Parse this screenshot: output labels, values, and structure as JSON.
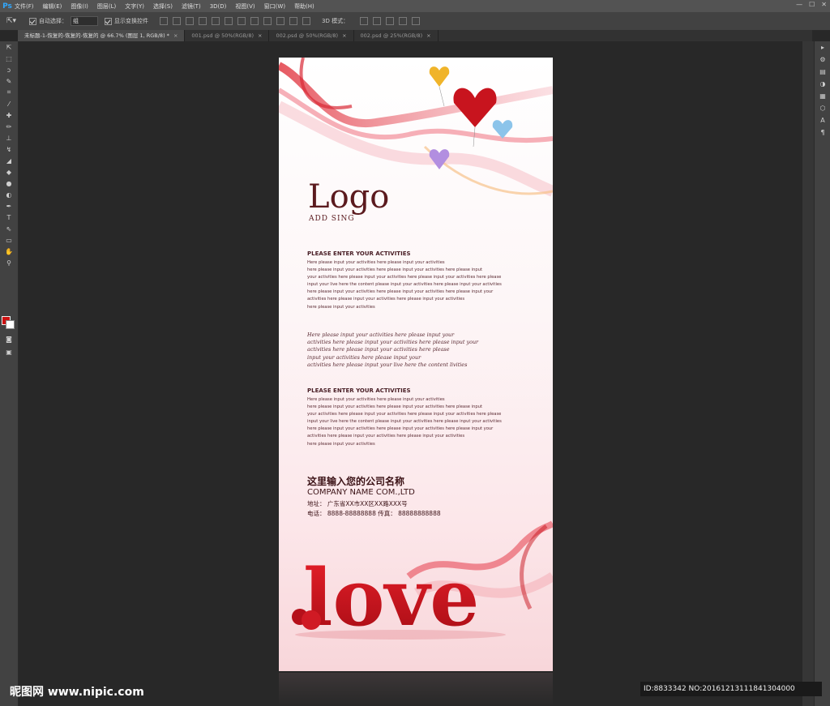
{
  "app": {
    "logo": "Ps"
  },
  "menu": [
    "文件(F)",
    "编辑(E)",
    "图像(I)",
    "图层(L)",
    "文字(Y)",
    "选择(S)",
    "滤镜(T)",
    "3D(D)",
    "视图(V)",
    "窗口(W)",
    "帮助(H)"
  ],
  "window_controls": [
    "—",
    "☐",
    "✕"
  ],
  "options": {
    "auto_select_label": "自动选择：",
    "auto_select_value": "组",
    "show_transform_label": "显示变换控件",
    "mode_3d_label": "3D 模式："
  },
  "tabs": [
    {
      "label": "未标题-1-恢复的-恢复的-恢复的 @ 66.7% (图层 1, RGB/8) *",
      "active": true
    },
    {
      "label": "001.psd @ 50%(RGB/8)",
      "active": false
    },
    {
      "label": "002.psd @ 50%(RGB/8)",
      "active": false
    },
    {
      "label": "002.psd @ 25%(RGB/8)",
      "active": false
    }
  ],
  "tools": [
    "move-icon",
    "marquee-icon",
    "lasso-icon",
    "quick-select-icon",
    "crop-icon",
    "eyedropper-icon",
    "healing-icon",
    "brush-icon",
    "stamp-icon",
    "history-brush-icon",
    "eraser-icon",
    "gradient-icon",
    "blur-icon",
    "dodge-icon",
    "pen-icon",
    "type-icon",
    "path-select-icon",
    "shape-icon",
    "hand-icon",
    "zoom-icon"
  ],
  "tool_glyphs": [
    "⇱",
    "⬚",
    "ↄ",
    "✎",
    "⌗",
    "⁄",
    "✚",
    "✏",
    "⊥",
    "↯",
    "◢",
    "◆",
    "●",
    "◐",
    "✒",
    "T",
    "⇖",
    "▭",
    "✋",
    "⚲"
  ],
  "right_panel_glyphs": [
    "▸",
    "⚙",
    "▤",
    "◑",
    "▦",
    "⬡",
    "A",
    "¶"
  ],
  "colors": {
    "foreground": "#cc1111",
    "background": "#ffffff",
    "accent_red": "#d8121f"
  },
  "poster": {
    "logo": "Logo",
    "logo_sub": "ADD SING",
    "section1_heading": "PLEASE ENTER YOUR ACTIVITIES",
    "section1_lines": [
      "Here please input your activities here please input your activities",
      "here please input your activities here please input your activities here please input",
      "your activities here please input your activities here please input your activities here please",
      "input your live here the content please input your activities here please input your activities",
      "here please input your activities here please input your activities here please input your",
      " activities here please input your activities here please input your activities",
      "here please input your activities"
    ],
    "script_lines": [
      "Here please input your activities here please input your",
      "activities here please input your activities here please input your",
      "activities here please input your activities here please",
      "input your activities here please input your",
      "activities here please input your live here the content livities"
    ],
    "section2_heading": "PLEASE ENTER YOUR ACTIVITIES",
    "section2_lines": [
      "Here please input your activities here please input your activities",
      "here please input your activities here please input your activities here please input",
      "your activities here please input your activities here please input your activities here please",
      "input your live here the content please input your activities here please input your activities",
      "here please input your activities here please input your activities here please input your",
      " activities here please input your activities here please input your activities",
      "here please input your activities"
    ],
    "company_cn": "这里输入您的公司名称",
    "company_en": "COMPANY NAME COM.,LTD",
    "address": "地址：  广东省XX市XX区XX路XXX号",
    "phone": "电话：  8888-88888888  传真：  88888888888",
    "love_text": "love"
  },
  "watermark": {
    "left": "昵图网 www.nipic.com",
    "right": "ID:8833342 NO:20161213111841304000"
  }
}
